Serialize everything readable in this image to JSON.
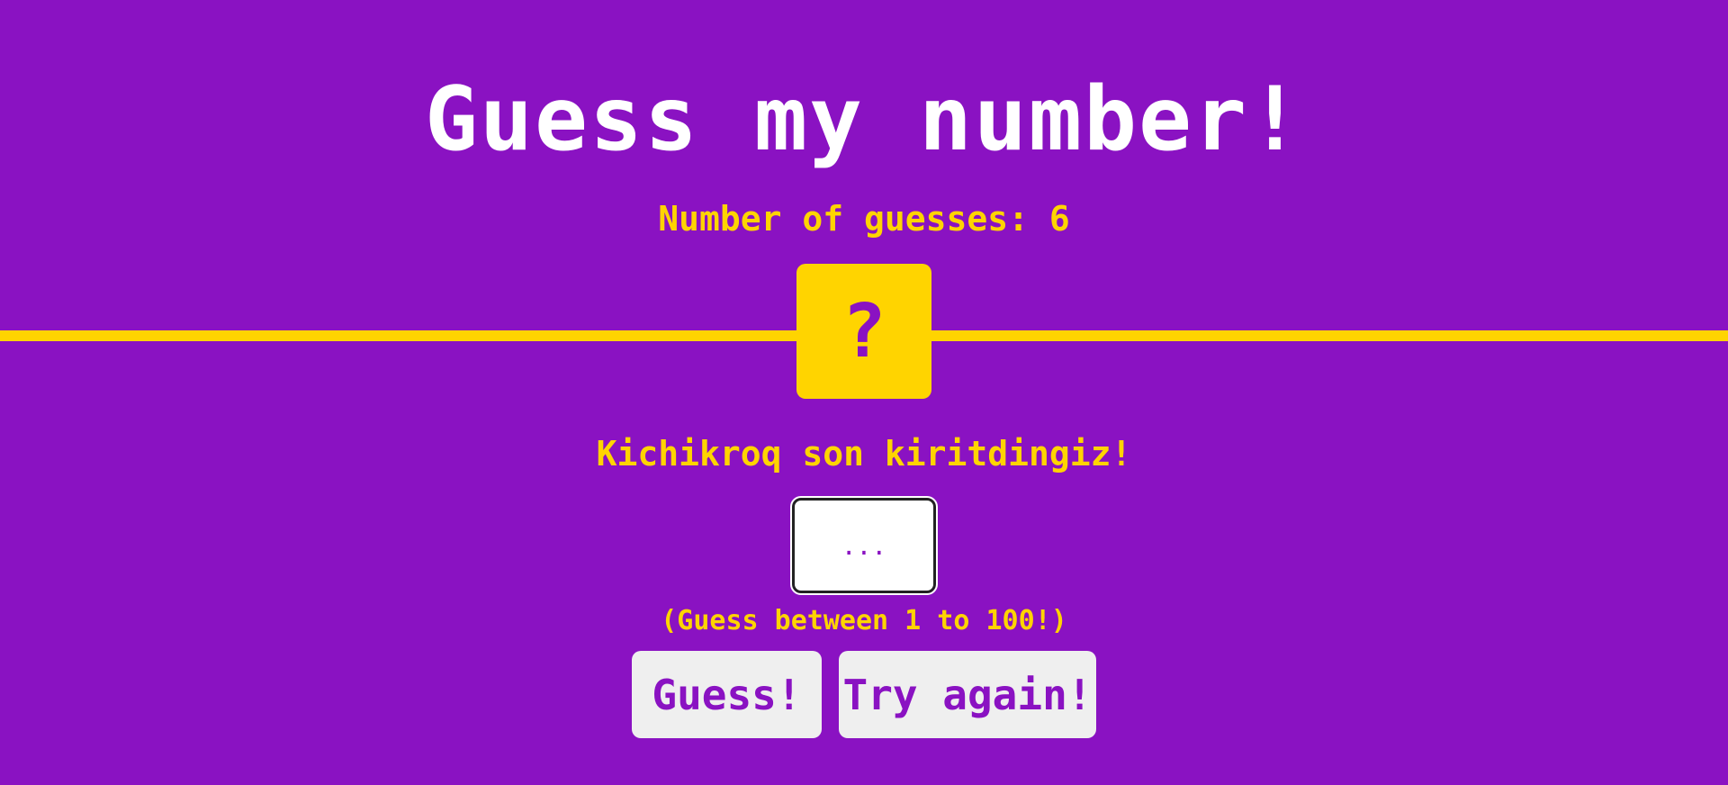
{
  "game": {
    "title": "Guess my number!",
    "guess_count_text": "Number of guesses: 6",
    "secret_display": "?",
    "message": "Kichikroq son kiritdingiz!",
    "input": {
      "value": "",
      "placeholder": "..."
    },
    "hint": "(Guess between 1 to 100!)",
    "buttons": {
      "guess_label": "Guess!",
      "try_again_label": "Try again!"
    }
  },
  "colors": {
    "background": "#8a12c2",
    "accent": "#ffd400",
    "title": "#ffffff",
    "button_bg": "#efefef"
  }
}
